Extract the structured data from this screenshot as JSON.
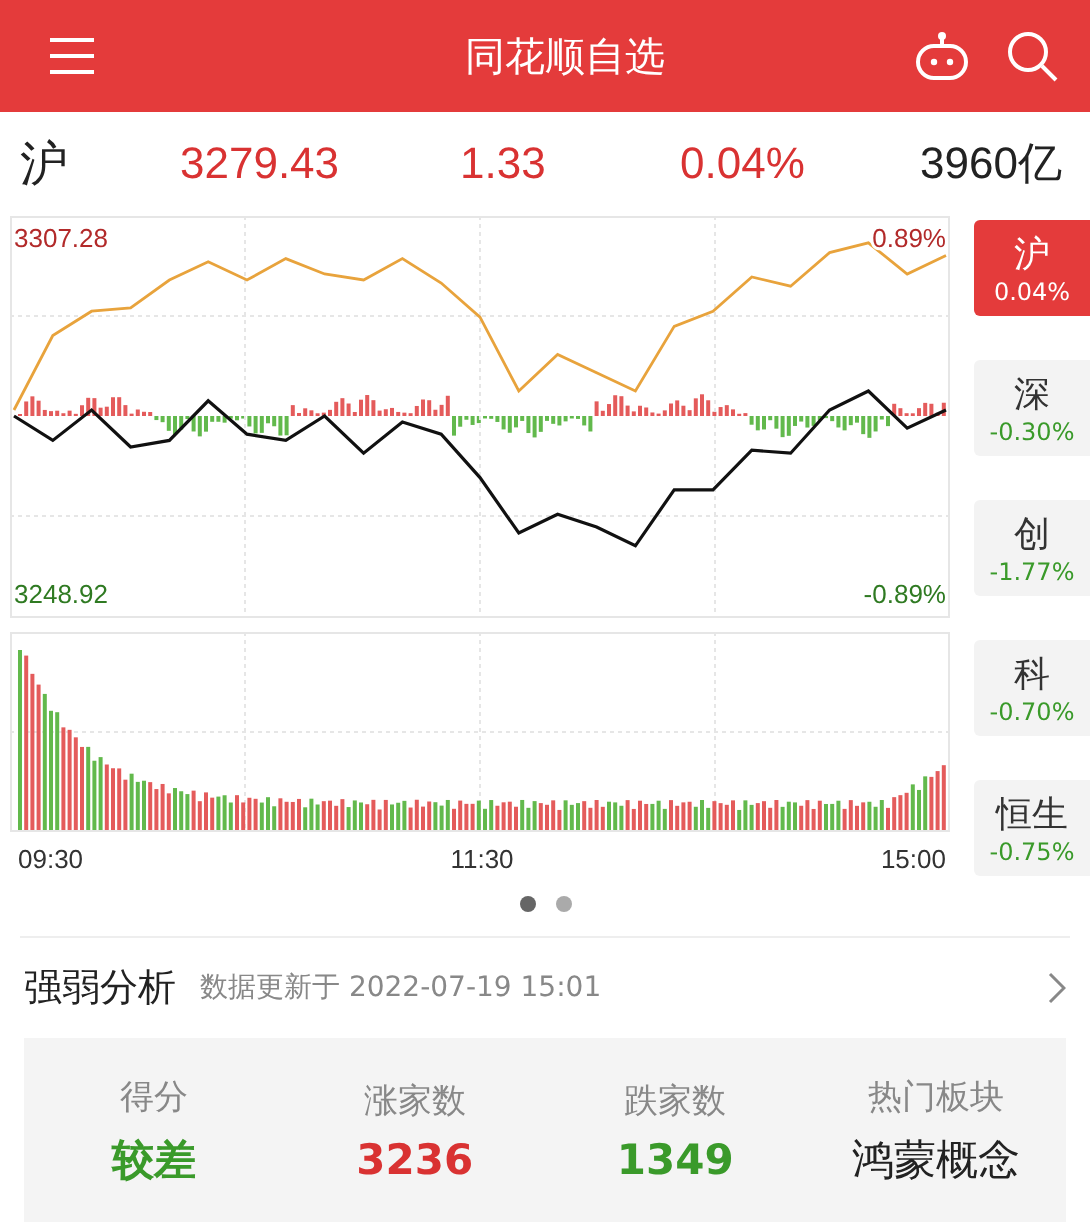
{
  "header": {
    "title": "同花顺自选"
  },
  "quote": {
    "name": "沪",
    "price": "3279.43",
    "change": "1.33",
    "percent": "0.04%",
    "turnover": "3960亿"
  },
  "chart": {
    "top_percent": "0.89%",
    "bottom_percent": "-0.89%",
    "times": [
      "09:30",
      "11:30",
      "15:00"
    ],
    "chart_data": {
      "type": "line",
      "grid": true,
      "ylim": [
        3245.3,
        3310.9
      ],
      "yticks": [
        {
          "value": 3248.92,
          "label": "3248.92"
        },
        {
          "value": 3307.28,
          "label": "3307.28"
        }
      ],
      "series": [
        {
          "color": "#e8a33c",
          "values": [
            3279.1,
            3291.3,
            3295.3,
            3295.8,
            3300.4,
            3303.4,
            3300.4,
            3303.9,
            3301.4,
            3300.4,
            3303.9,
            3299.9,
            3294.3,
            3282.2,
            3288.2,
            3285.2,
            3282.2,
            3292.8,
            3295.3,
            3300.9,
            3299.4,
            3304.9,
            3306.5,
            3301.4,
            3304.4
          ]
        },
        {
          "color": "#111111",
          "values": [
            3278.1,
            3274.1,
            3279.1,
            3273.0,
            3274.1,
            3280.6,
            3275.1,
            3274.1,
            3278.1,
            3272.0,
            3277.1,
            3275.1,
            3268.0,
            3258.9,
            3262.0,
            3259.9,
            3256.8,
            3266.0,
            3266.0,
            3272.5,
            3272.0,
            3279.1,
            3282.2,
            3276.1,
            3279.1
          ]
        }
      ]
    }
  },
  "index_tabs": [
    {
      "name": "沪",
      "change": "0.04%",
      "selected": true
    },
    {
      "name": "深",
      "change": "-0.30%",
      "selected": false
    },
    {
      "name": "创",
      "change": "-1.77%",
      "selected": false
    },
    {
      "name": "科",
      "change": "-0.70%",
      "selected": false
    },
    {
      "name": "恒生",
      "change": "-0.75%",
      "selected": false
    }
  ],
  "pager": [
    {
      "selected": true
    },
    {
      "selected": false
    }
  ],
  "analysis": {
    "title": "强弱分析",
    "updated": "数据更新于 2022-07-19 15:01",
    "stats": [
      {
        "label": "得分",
        "value": "较差",
        "color": "#3a9a2a"
      },
      {
        "label": "涨家数",
        "value": "3236",
        "color": "#d93232"
      },
      {
        "label": "跌家数",
        "value": "1349",
        "color": "#3a9a2a"
      },
      {
        "label": "热门板块",
        "value": "鸿蒙概念",
        "color": "#222222"
      }
    ]
  }
}
